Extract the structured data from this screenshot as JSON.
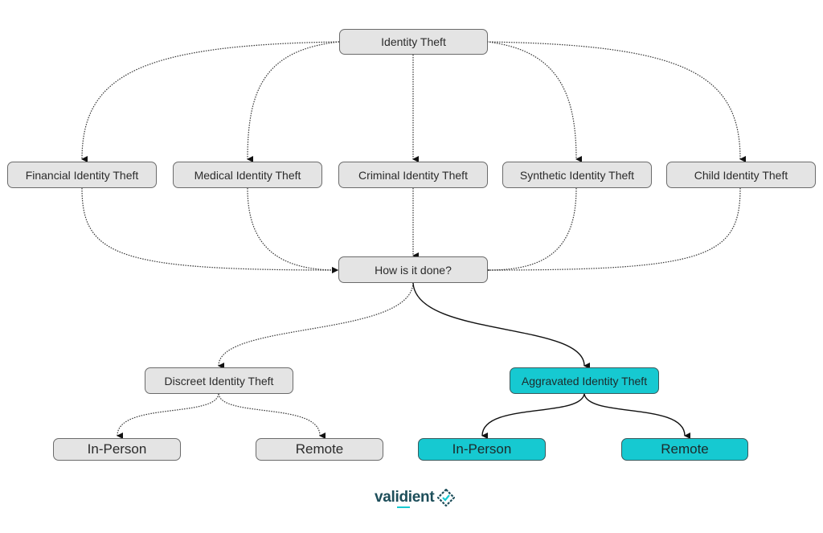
{
  "diagram": {
    "nodes": {
      "root": {
        "label": "Identity Theft"
      },
      "financial": {
        "label": "Financial Identity Theft"
      },
      "medical": {
        "label": "Medical Identity Theft"
      },
      "criminal": {
        "label": "Criminal Identity Theft"
      },
      "synthetic": {
        "label": "Synthetic Identity Theft"
      },
      "child": {
        "label": "Child Identity Theft"
      },
      "how": {
        "label": "How is it done?"
      },
      "discreet": {
        "label": "Discreet Identity Theft"
      },
      "aggravated": {
        "label": "Aggravated Identity Theft"
      },
      "discreet_inperson": {
        "label": "In-Person"
      },
      "discreet_remote": {
        "label": "Remote"
      },
      "aggravated_inperson": {
        "label": "In-Person"
      },
      "aggravated_remote": {
        "label": "Remote"
      }
    },
    "edges": [
      {
        "from": "root",
        "to": "financial",
        "style": "dotted"
      },
      {
        "from": "root",
        "to": "medical",
        "style": "dotted"
      },
      {
        "from": "root",
        "to": "criminal",
        "style": "dotted"
      },
      {
        "from": "root",
        "to": "synthetic",
        "style": "dotted"
      },
      {
        "from": "root",
        "to": "child",
        "style": "dotted"
      },
      {
        "from": "financial",
        "to": "how",
        "style": "dotted"
      },
      {
        "from": "medical",
        "to": "how",
        "style": "dotted"
      },
      {
        "from": "criminal",
        "to": "how",
        "style": "dotted"
      },
      {
        "from": "synthetic",
        "to": "how",
        "style": "dotted"
      },
      {
        "from": "child",
        "to": "how",
        "style": "dotted"
      },
      {
        "from": "how",
        "to": "discreet",
        "style": "dotted"
      },
      {
        "from": "how",
        "to": "aggravated",
        "style": "solid"
      },
      {
        "from": "discreet",
        "to": "discreet_inperson",
        "style": "dotted"
      },
      {
        "from": "discreet",
        "to": "discreet_remote",
        "style": "dotted"
      },
      {
        "from": "aggravated",
        "to": "aggravated_inperson",
        "style": "solid"
      },
      {
        "from": "aggravated",
        "to": "aggravated_remote",
        "style": "solid"
      }
    ],
    "colors": {
      "neutral": "#e4e4e4",
      "highlight": "#16c9d1",
      "brand": "#1d4e5a"
    }
  },
  "logo": {
    "text": "validient",
    "icon": "validient-diamond-icon"
  }
}
